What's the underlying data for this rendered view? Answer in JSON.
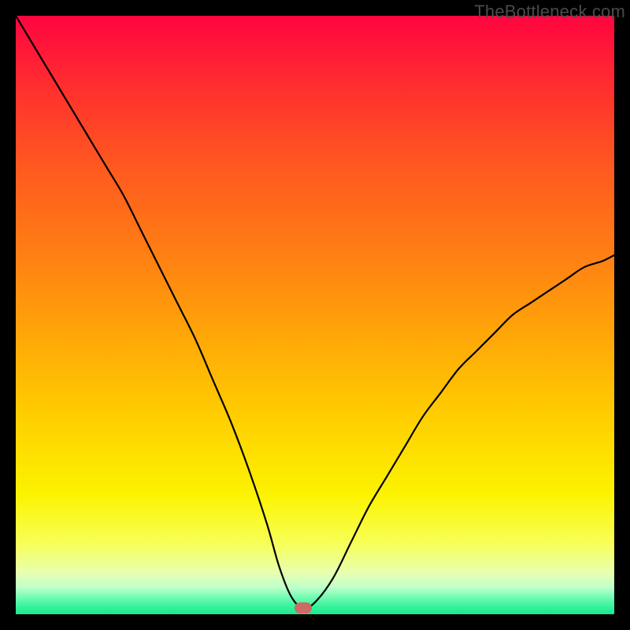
{
  "watermark": "TheBottleneck.com",
  "colors": {
    "frame": "#000000",
    "curve": "#000000",
    "marker": "#cc6a63",
    "gradient_top": "#ff063f",
    "gradient_bottom": "#18e98e"
  },
  "chart_data": {
    "type": "line",
    "title": "",
    "xlabel": "",
    "ylabel": "",
    "xlim": [
      0,
      100
    ],
    "ylim": [
      0,
      100
    ],
    "grid": false,
    "optimum_x": 48,
    "series": [
      {
        "name": "bottleneck-curve",
        "x": [
          0,
          3,
          6,
          9,
          12,
          15,
          18,
          21,
          24,
          27,
          30,
          33,
          36,
          39,
          42,
          44,
          46,
          48,
          50,
          53,
          56,
          59,
          62,
          65,
          68,
          71,
          74,
          77,
          80,
          83,
          86,
          89,
          92,
          95,
          98,
          100
        ],
        "values": [
          100,
          95,
          90,
          85,
          80,
          75,
          70,
          64,
          58,
          52,
          46,
          39,
          32,
          24,
          15,
          8,
          3,
          1,
          2,
          6,
          12,
          18,
          23,
          28,
          33,
          37,
          41,
          44,
          47,
          50,
          52,
          54,
          56,
          58,
          59,
          60
        ]
      }
    ],
    "annotations": [
      {
        "name": "optimum-marker",
        "x": 48,
        "y": 1
      }
    ]
  }
}
